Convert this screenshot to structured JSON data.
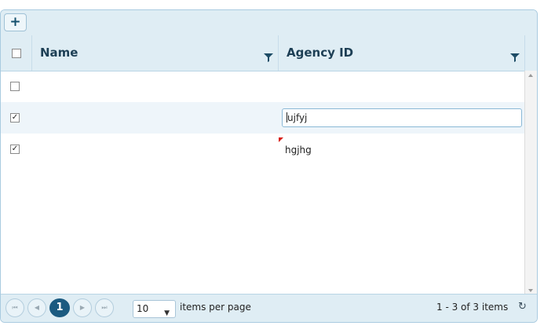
{
  "toolbar": {
    "add_label": "+"
  },
  "columns": {
    "name": "Name",
    "agency": "Agency ID"
  },
  "rows": [
    {
      "checked": false,
      "agency_id": ""
    },
    {
      "checked": true,
      "agency_id": "ujfyj",
      "editing": true
    },
    {
      "checked": true,
      "agency_id": "hgjhg",
      "dirty": true
    }
  ],
  "checkbox": {
    "checked_glyph": "✓",
    "unchecked_glyph": ""
  },
  "pager": {
    "first": "⏮",
    "prev": "◀",
    "current": "1",
    "next": "▶",
    "last": "⏭",
    "page_size": "10",
    "page_size_caret": "▼",
    "items_per_page_label": "items per page",
    "info": "1 - 3 of 3 items",
    "refresh": "↻"
  },
  "colors": {
    "header_bg": "#dfedf4",
    "accent": "#1b5a80",
    "dirty_marker": "#d8201a"
  }
}
